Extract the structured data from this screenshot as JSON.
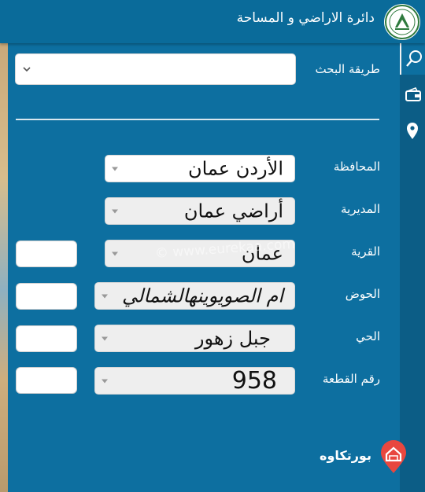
{
  "header": {
    "title": "دائرة الاراضي و المساحة",
    "logo_icon": "dls-logo-icon"
  },
  "sidebar": {
    "items": [
      {
        "icon": "search-icon",
        "active": true
      },
      {
        "icon": "wallet-icon",
        "active": false
      },
      {
        "icon": "location-pin-icon",
        "active": false
      }
    ]
  },
  "form": {
    "search_method": {
      "label": "طريقة البحث",
      "value": ""
    },
    "governorate": {
      "label": "المحافظة",
      "value": "الأردن عمان"
    },
    "directorate": {
      "label": "المديرية",
      "value": "أراضي عمان"
    },
    "village": {
      "label": "القرية",
      "value": "عمان"
    },
    "basin": {
      "label": "الحوض",
      "value": "ام الصويوينهالشمالي"
    },
    "neighborhood": {
      "label": "الحي",
      "value": "جبل زهور"
    },
    "plot_number": {
      "label": "رقم القطعة",
      "value": "958"
    }
  },
  "watermark": "© www.eurekaa.com",
  "brand": {
    "name": "بورتكاوه",
    "color": "#e8473f"
  },
  "colors": {
    "header": "#0a6b9a",
    "panel": "#0d6fa0",
    "rail": "#0c5d86"
  }
}
